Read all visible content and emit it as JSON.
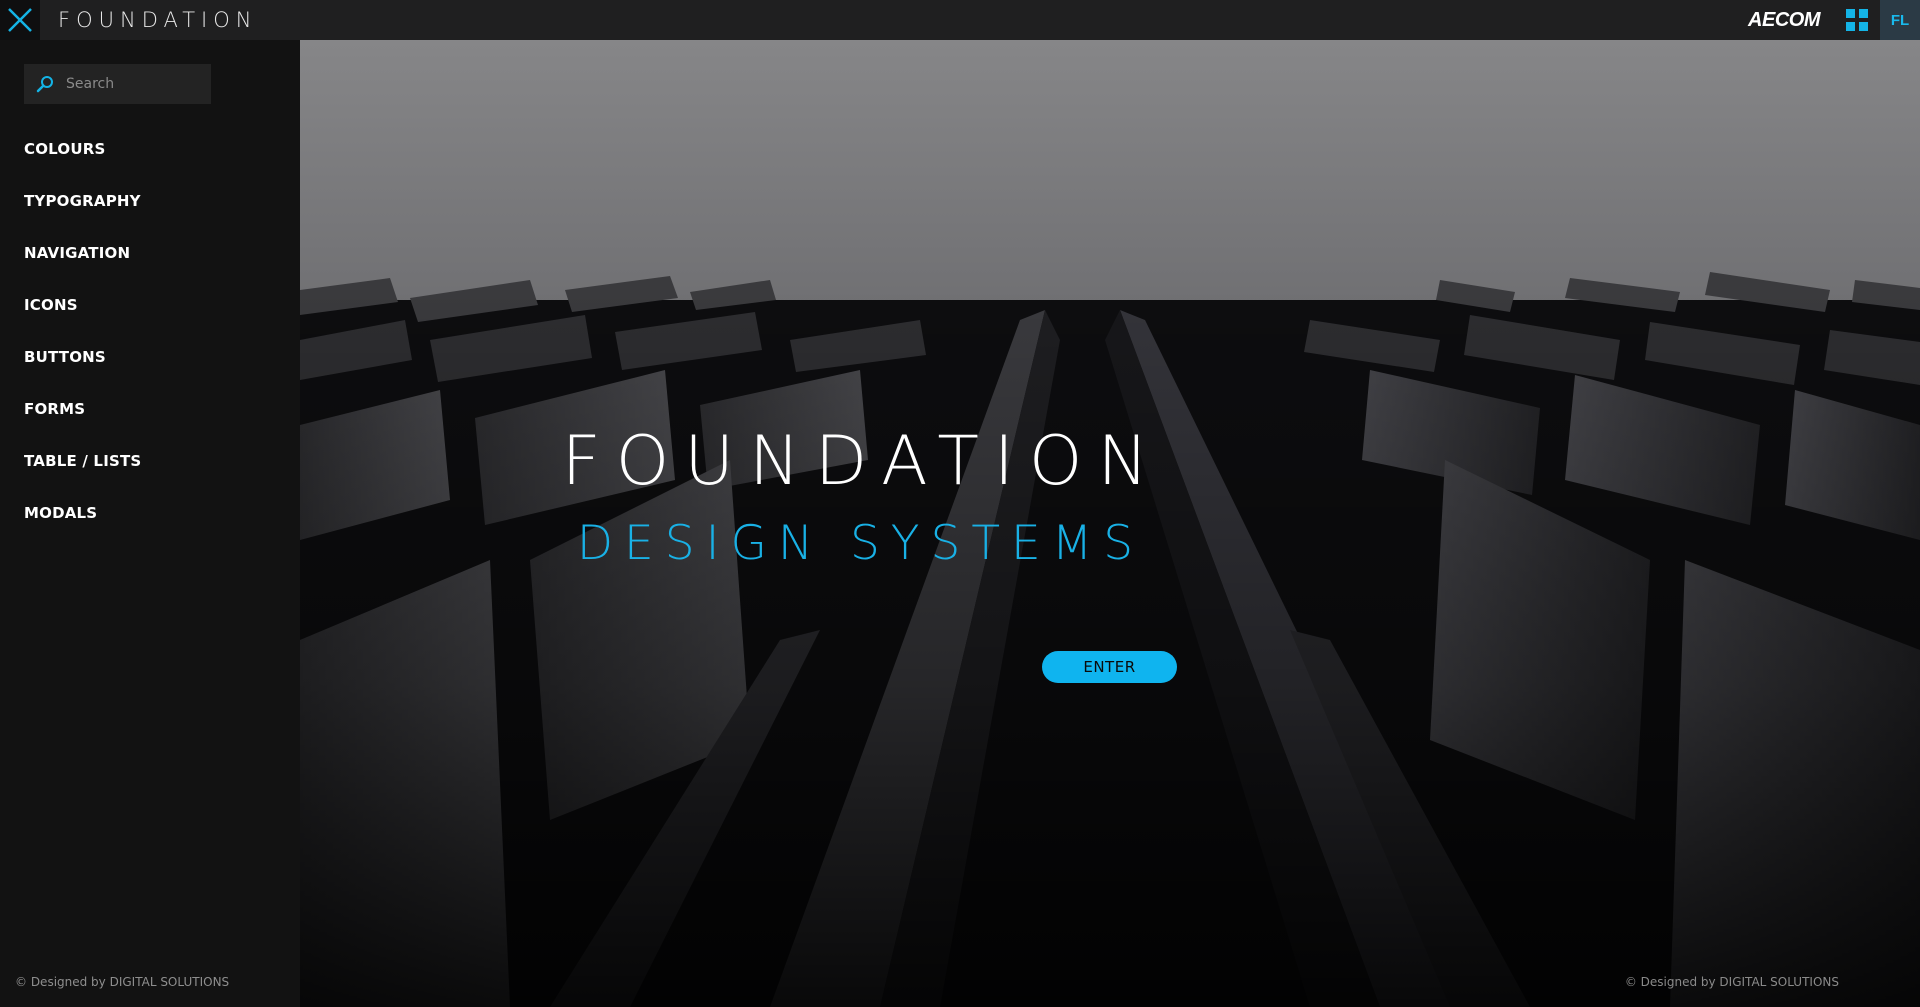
{
  "topbar": {
    "brand_title": "FOUNDATION",
    "close_icon": "close-icon",
    "company_logo": "AECOM",
    "apps_icon": "grid-icon",
    "user_initials": "FL"
  },
  "sidebar": {
    "search": {
      "placeholder": "Search",
      "value": "",
      "icon": "search-icon"
    },
    "items": [
      {
        "label": "COLOURS"
      },
      {
        "label": "TYPOGRAPHY"
      },
      {
        "label": "NAVIGATION"
      },
      {
        "label": "ICONS"
      },
      {
        "label": "BUTTONS"
      },
      {
        "label": "FORMS"
      },
      {
        "label": "TABLE / LISTS"
      },
      {
        "label": "MODALS"
      }
    ],
    "footer": "© Designed by DIGITAL SOLUTIONS"
  },
  "hero": {
    "title": "FOUNDATION",
    "subtitle": "DESIGN SYSTEMS",
    "enter_label": "ENTER",
    "footer": "© Designed by DIGITAL SOLUTIONS"
  },
  "colors": {
    "accent": "#14b4e6",
    "topbar": "#1f1f20",
    "sidebar": "#121212",
    "enter_button": "#0fb4ef"
  }
}
